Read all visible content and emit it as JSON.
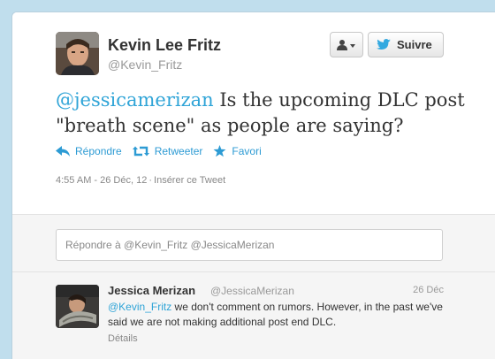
{
  "tweet": {
    "author_name": "Kevin Lee Fritz",
    "author_handle": "@Kevin_Fritz",
    "mention": "@jessicamerizan",
    "text": " Is the upcoming DLC post \"breath scene\" as people are saying?",
    "actions": {
      "reply": "Répondre",
      "retweet": "Retweeter",
      "favorite": "Favori"
    },
    "timestamp": "4:55 AM - 26 Déc, 12",
    "separator": "·",
    "embed": "Insérer ce Tweet"
  },
  "header_buttons": {
    "follow": "Suivre"
  },
  "reply_box": {
    "placeholder": "Répondre à @Kevin_Fritz @JessicaMerizan"
  },
  "reply": {
    "name": "Jessica Merizan",
    "handle": "@JessicaMerizan",
    "date": "26 Déc",
    "mention": "@Kevin_Fritz",
    "text": " we don't comment on rumors. However, in the past we've said we are not making additional post end DLC.",
    "details": "Détails"
  },
  "colors": {
    "link": "#2d9bd4",
    "page_bg": "#c0deed",
    "twitter_blue": "#33a9e0"
  },
  "icons": [
    "person-icon",
    "chevron-down-icon",
    "twitter-bird-icon",
    "reply-arrow-icon",
    "retweet-icon",
    "star-icon"
  ]
}
